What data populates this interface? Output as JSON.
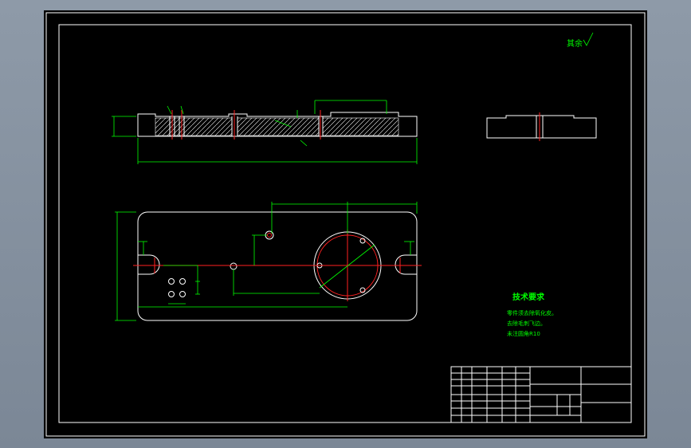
{
  "surface_finish_note": "其余",
  "technical_requirements": {
    "title": "技术要求",
    "lines": [
      "零件须去除氧化皮。",
      "去除毛刺飞边。",
      "未注圆角R10"
    ]
  },
  "colors": {
    "background": "#000000",
    "border": "#ffffff",
    "dimension": "#00ff00",
    "centerline": "#ff2020",
    "outer_frame": "#8e9aa8"
  }
}
